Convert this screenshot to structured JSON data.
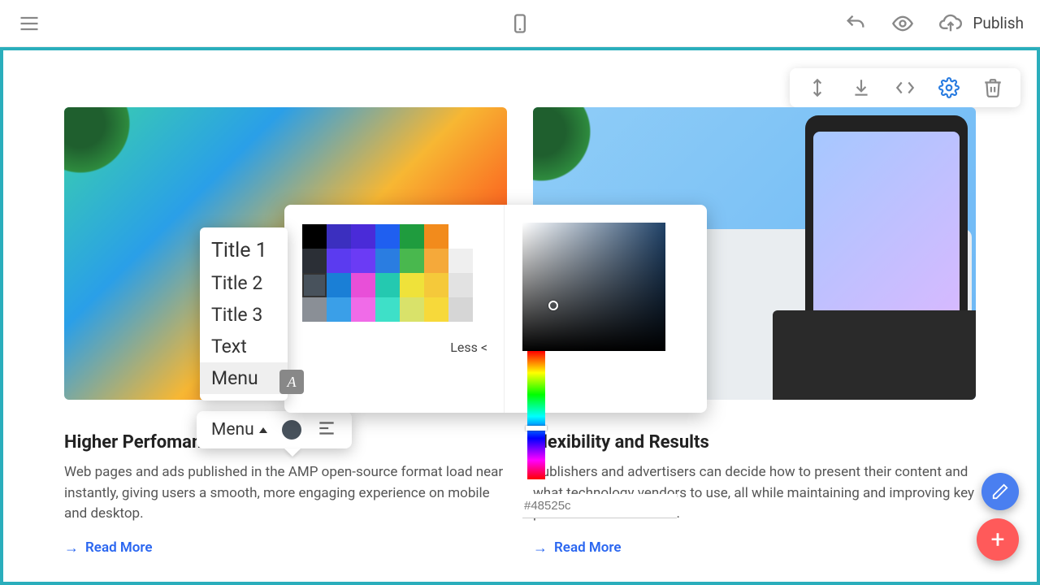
{
  "topbar": {
    "publish_label": "Publish"
  },
  "section_toolbar": {
    "move": "move-vertical-icon",
    "down": "arrow-down-icon",
    "code": "code-icon",
    "settings": "gear-icon",
    "delete": "trash-icon"
  },
  "cards": [
    {
      "title": "Higher Perfomance",
      "body": "Web pages and ads published in the AMP open-source format load near instantly, giving users a smooth, more engaging experience on mobile and desktop.",
      "cta": "Read More"
    },
    {
      "title": "Flexibility and Results",
      "body": "Publishers and advertisers can decide how to present their content and what technology vendors to use, all while maintaining and improving key performance indicators.",
      "cta": "Read More"
    }
  ],
  "style_list": {
    "items": [
      "Title 1",
      "Title 2",
      "Title 3",
      "Text",
      "Menu"
    ],
    "selected_index": 4
  },
  "mini_toolbar": {
    "label": "Menu"
  },
  "color_picker": {
    "less_label": "Less <",
    "hex_value": "#48525c",
    "swatches": [
      [
        "#000000",
        "#3b2fbf",
        "#4a2bd8",
        "#1f5ff0",
        "#1f9c3e",
        "#f28b1c",
        "#ffffff"
      ],
      [
        "#2b2f36",
        "#5b3bf0",
        "#6b3bf5",
        "#2a7de1",
        "#49b84e",
        "#f5a93a",
        "#efefef"
      ],
      [
        "#48525c",
        "#1a7fd6",
        "#e84fd8",
        "#24c9b0",
        "#efe23a",
        "#f5c93a",
        "#e2e2e2"
      ],
      [
        "#8a8f96",
        "#3a9fe8",
        "#f06be8",
        "#3ee0c8",
        "#d9e26a",
        "#f7d93a",
        "#d6d6d6"
      ]
    ],
    "selected_swatch": [
      2,
      0
    ]
  }
}
